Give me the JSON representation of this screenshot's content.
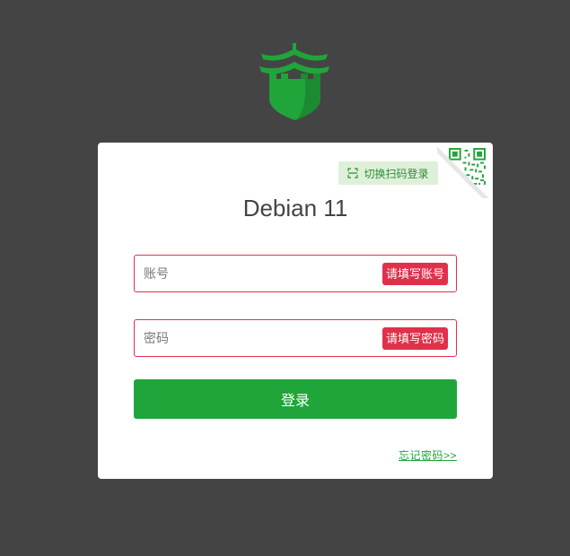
{
  "page": {
    "background_color": "#444444"
  },
  "logo": {
    "icon": "castle-shield-logo-icon"
  },
  "login_card": {
    "switch_qr": {
      "label": "切换扫码登录",
      "icon": "scan-icon"
    },
    "qr_corner": {
      "icon": "qr-code-icon"
    },
    "title": "Debian 11",
    "username": {
      "placeholder": "账号",
      "value": "",
      "error_tip": "请填写账号"
    },
    "password": {
      "placeholder": "密码",
      "value": "",
      "error_tip": "请填写密码"
    },
    "submit_label": "登录",
    "forgot_password_label": "忘记密码>>"
  },
  "colors": {
    "accent": "#20a53a",
    "accent_dark": "#1b8a30",
    "error": "#e0314b",
    "badge_background": "#dff0d8",
    "badge_text": "#2e8b3a"
  }
}
